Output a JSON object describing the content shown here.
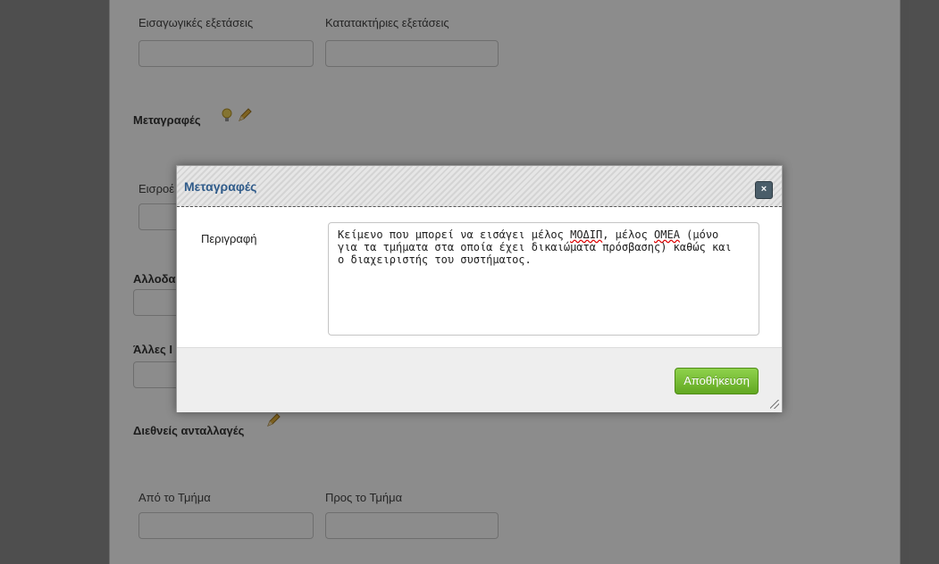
{
  "page": {
    "entrance_exams_label": "Εισαγωγικές εξετάσεις",
    "placement_exams_label": "Κατατακτήριες εξετάσεις",
    "transfers_heading": "Μεταγραφές",
    "inflows_label_partial": "Εισροέ",
    "foreign_heading_partial": "Αλλοδα",
    "other_heading_partial": "Άλλες Ι",
    "international_heading": "Διεθνείς ανταλλαγές",
    "from_dept_label": "Από το Τμήμα",
    "to_dept_label": "Προς το Τμήμα"
  },
  "modal": {
    "title": "Μεταγραφές",
    "close_symbol": "×",
    "description_label": "Περιγραφή",
    "description_parts": [
      "Κείμενο που μπορεί να εισάγει μέλος ",
      "ΜΟΔΙΠ",
      ", μέλος ",
      "ΟΜΕΑ",
      " (μόνο\nγια τα τμήματα στα οποία έχει δικαιώματα πρόσβασης) καθώς και\nο διαχειριστής του συστήματος."
    ],
    "save_label": "Αποθήκευση"
  },
  "icons": {
    "lightbulb": "lightbulb-icon",
    "pencil": "pencil-icon"
  }
}
